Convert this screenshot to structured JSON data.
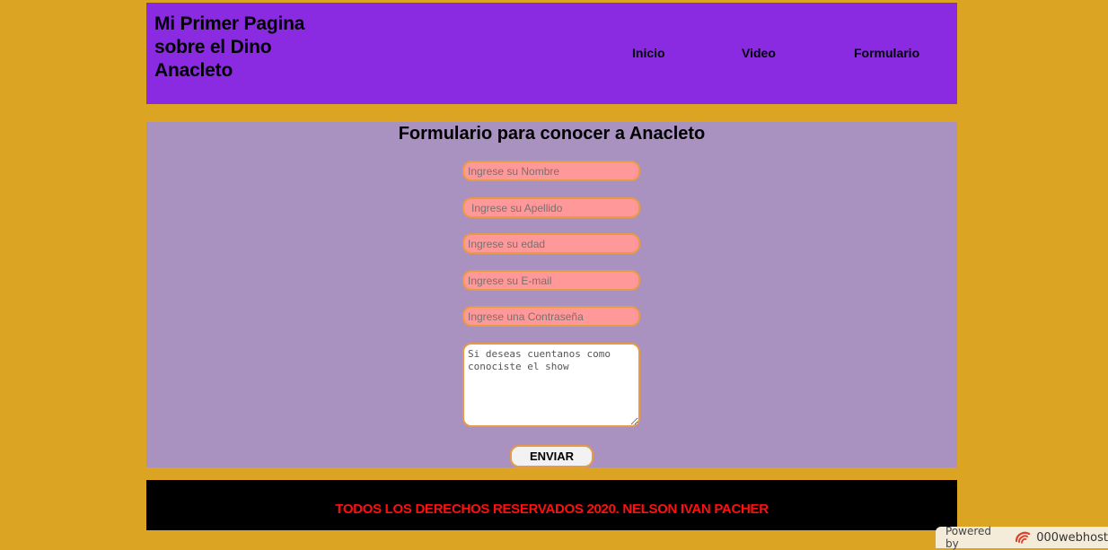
{
  "header": {
    "site_title": "Mi Primer Pagina sobre el Dino Anacleto",
    "nav": {
      "inicio": "Inicio",
      "video": "Video",
      "formulario": "Formulario"
    }
  },
  "form": {
    "title": "Formulario para conocer a Anacleto",
    "nombre_placeholder": "Ingrese su Nombre",
    "apellido_placeholder": "Ingrese su Apellido",
    "edad_placeholder": "Ingrese su edad",
    "email_placeholder": "Ingrese su E-mail",
    "password_placeholder": "Ingrese una Contraseña",
    "message_placeholder": "Si deseas cuentanos como conociste el show",
    "submit_label": "ENVIAR"
  },
  "footer": {
    "copyright": "TODOS LOS DERECHOS RESERVADOS 2020. NELSON IVAN PACHER"
  },
  "badge": {
    "powered": "Powered by",
    "brand": "000webhost",
    "logo_icon": "000webhost-logo-icon"
  },
  "colors": {
    "page_background": "#dba523",
    "header_background": "#8a2be2",
    "main_background": "#a991c0",
    "field_background": "#ff9999",
    "field_border": "#e99a48",
    "footer_background": "#000000",
    "footer_text": "#ff1010"
  }
}
